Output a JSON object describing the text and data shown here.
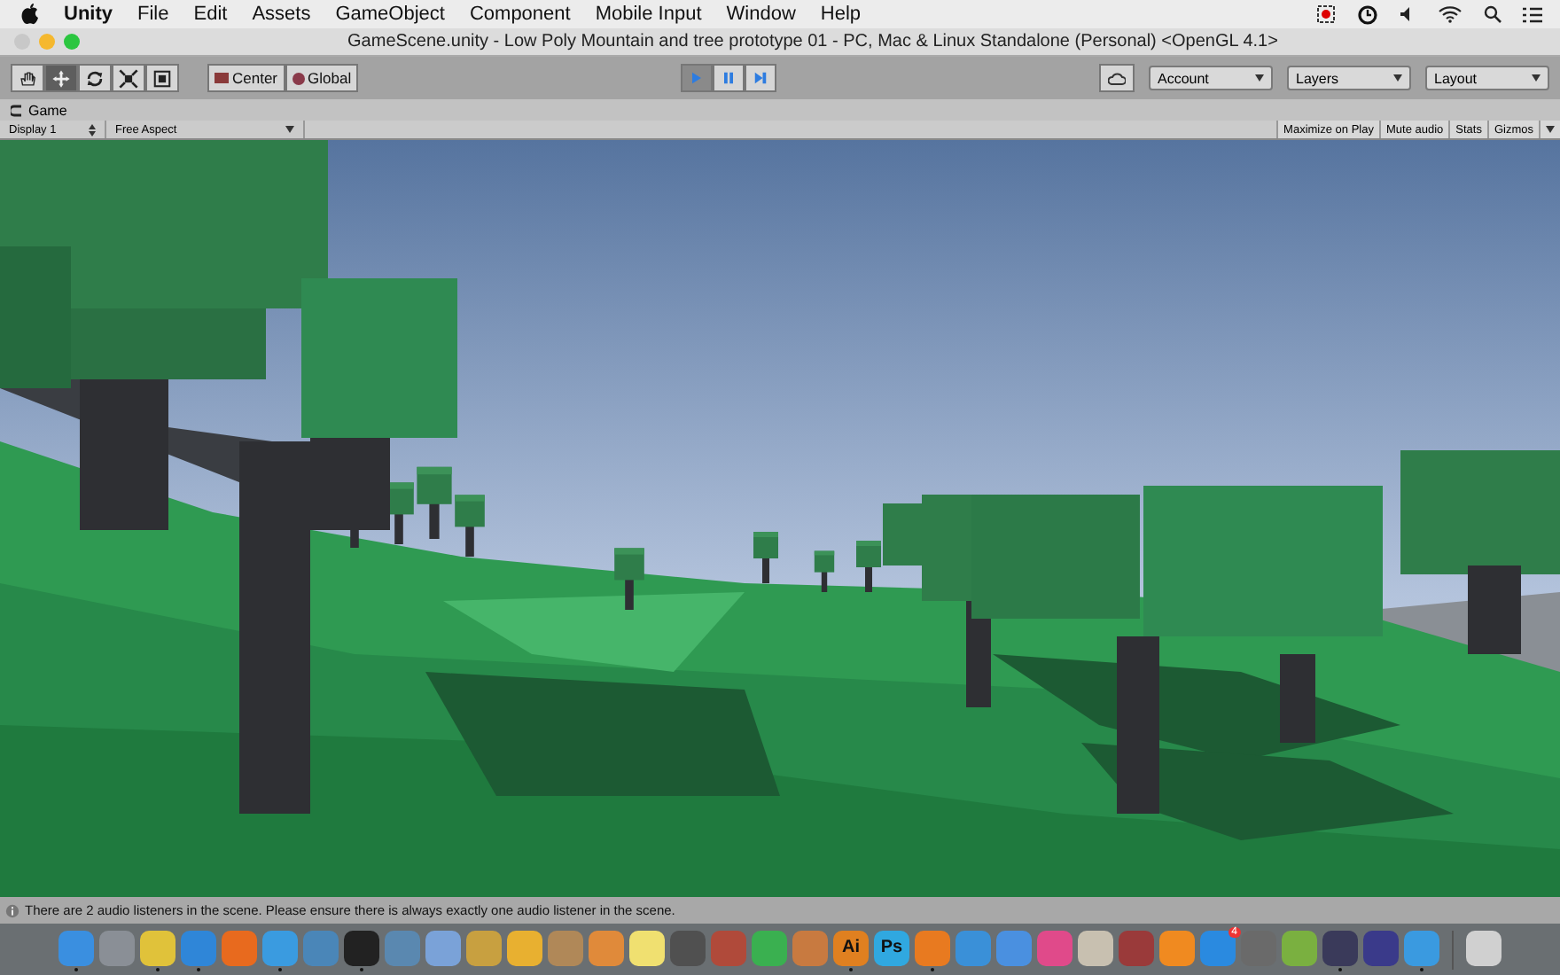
{
  "menu_bar": {
    "app": "Unity",
    "items": [
      "File",
      "Edit",
      "Assets",
      "GameObject",
      "Component",
      "Mobile Input",
      "Window",
      "Help"
    ]
  },
  "window": {
    "title": "GameScene.unity - Low Poly Mountain and tree prototype 01 - PC, Mac & Linux Standalone (Personal) <OpenGL 4.1>"
  },
  "toolbar": {
    "tools": [
      {
        "kind": "hand",
        "selected": false
      },
      {
        "kind": "move",
        "selected": true
      },
      {
        "kind": "rotate",
        "selected": false
      },
      {
        "kind": "scale",
        "selected": false
      },
      {
        "kind": "rect",
        "selected": false
      }
    ],
    "pivot": [
      "Center",
      "Global"
    ],
    "playback": [
      {
        "kind": "play",
        "selected": true
      },
      {
        "kind": "pause",
        "selected": false
      },
      {
        "kind": "step",
        "selected": false
      }
    ],
    "account": "Account",
    "layers": "Layers",
    "layout": "Layout"
  },
  "game_view": {
    "tab": "Game",
    "display": "Display 1",
    "aspect": "Free Aspect",
    "options": [
      "Maximize on Play",
      "Mute audio",
      "Stats",
      "Gizmos"
    ]
  },
  "status_bar": {
    "message": "There are 2 audio listeners in the scene. Please ensure there is always exactly one audio listener in the scene."
  },
  "dock": [
    {
      "color": "#3a8fe0",
      "running": true
    },
    {
      "color": "#8a8f96",
      "running": false
    },
    {
      "color": "#e0c23a",
      "running": true
    },
    {
      "color": "#2f86d8",
      "running": true
    },
    {
      "color": "#e86a1e",
      "running": false
    },
    {
      "color": "#3a9be0",
      "running": true
    },
    {
      "color": "#4a86b8",
      "running": false
    },
    {
      "color": "#222222",
      "running": true
    },
    {
      "color": "#5a88b0",
      "running": false
    },
    {
      "color": "#7aa2d8",
      "running": false
    },
    {
      "color": "#c8a040",
      "running": false
    },
    {
      "color": "#e8b030",
      "running": false
    },
    {
      "color": "#b08858",
      "running": false
    },
    {
      "color": "#e08a3a",
      "running": false
    },
    {
      "color": "#f0e070",
      "running": false
    },
    {
      "color": "#505050",
      "running": false
    },
    {
      "color": "#b04a3a",
      "running": false
    },
    {
      "color": "#3ab050",
      "running": false
    },
    {
      "color": "#c87a40",
      "running": false
    },
    {
      "label": "Ai",
      "color": "#e08020",
      "running": true
    },
    {
      "label": "Ps",
      "color": "#30a8e0",
      "running": false
    },
    {
      "color": "#e87a20",
      "running": true
    },
    {
      "color": "#3a90d8",
      "running": false
    },
    {
      "color": "#4a90e0",
      "running": false
    },
    {
      "color": "#e04a8a",
      "running": false
    },
    {
      "color": "#c8c0b0",
      "running": false
    },
    {
      "color": "#9a3a3a",
      "running": false
    },
    {
      "color": "#f08a20",
      "running": false
    },
    {
      "color": "#2a8ae0",
      "badge": "4",
      "running": false
    },
    {
      "color": "#6a6a6a",
      "running": false
    },
    {
      "color": "#7ab040",
      "running": false
    },
    {
      "color": "#3a3a5a",
      "running": true
    },
    {
      "color": "#3a3a8a",
      "running": false
    },
    {
      "color": "#3a9ae0",
      "running": true
    },
    {
      "color": "#d0d0d0",
      "trash": true,
      "running": false
    }
  ]
}
